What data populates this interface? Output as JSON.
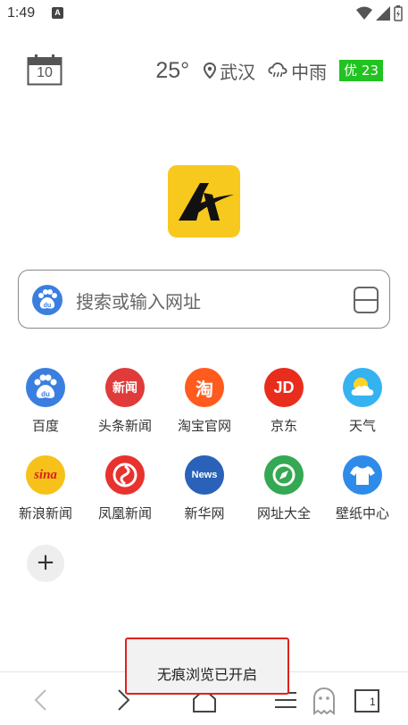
{
  "status": {
    "time": "1:49",
    "a_badge": "A"
  },
  "header": {
    "calendar_day": "10",
    "temperature": "25°",
    "location": "武汉",
    "condition": "中雨",
    "aqi": "优 23",
    "aqi_color": "#21c321"
  },
  "logo": {
    "letter": "A",
    "bg_color": "#f7c81e"
  },
  "search": {
    "placeholder": "搜索或输入网址",
    "engine_icon": "baidu-icon"
  },
  "shortcuts": [
    {
      "label": "百度",
      "icon": "baidu-icon",
      "color": "#3a7fe0",
      "glyph": "du"
    },
    {
      "label": "头条新闻",
      "icon": "news-icon",
      "color": "#e03a3a",
      "glyph": "新闻"
    },
    {
      "label": "淘宝官网",
      "icon": "taobao-icon",
      "color": "#ff5b1e",
      "glyph": "淘"
    },
    {
      "label": "京东",
      "icon": "jd-icon",
      "color": "#e82d1d",
      "glyph": "JD"
    },
    {
      "label": "天气",
      "icon": "weather-icon",
      "color": "#35b3f0",
      "glyph": ""
    },
    {
      "label": "新浪新闻",
      "icon": "sina-icon",
      "color": "#f6c21a",
      "glyph": "sina"
    },
    {
      "label": "凤凰新闻",
      "icon": "ifeng-icon",
      "color": "#e8322e",
      "glyph": ""
    },
    {
      "label": "新华网",
      "icon": "xinhua-icon",
      "color": "#2962b8",
      "glyph": "News"
    },
    {
      "label": "网址大全",
      "icon": "compass-icon",
      "color": "#34a853",
      "glyph": ""
    },
    {
      "label": "壁纸中心",
      "icon": "tshirt-icon",
      "color": "#2e8bea",
      "glyph": ""
    }
  ],
  "add_button": "+",
  "toast": {
    "text": "无痕浏览已开启"
  },
  "bottom_nav": {
    "tabs_count": "1"
  }
}
